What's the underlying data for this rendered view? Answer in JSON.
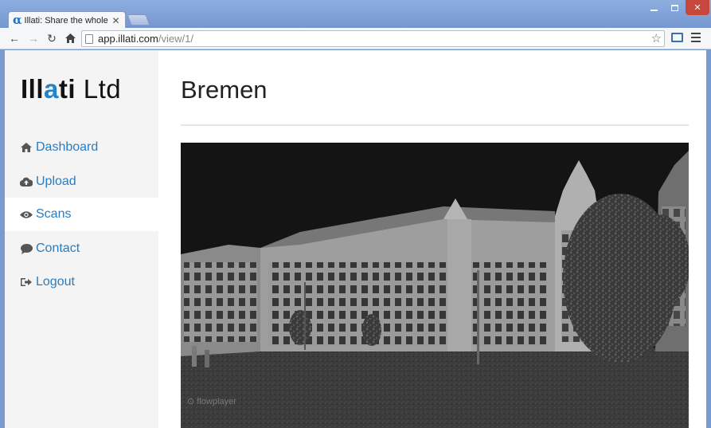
{
  "browser": {
    "tab_title": "Illati: Share the whole clou",
    "tab_favicon": "α",
    "url_host": "app.illati.com",
    "url_path": "/view/1/"
  },
  "sidebar": {
    "logo": {
      "part1": "Ill",
      "part2": "a",
      "part3": "ti",
      "part4": " Ltd"
    },
    "items": [
      {
        "label": "Dashboard",
        "icon": "home-icon"
      },
      {
        "label": "Upload",
        "icon": "cloud-upload-icon"
      },
      {
        "label": "Scans",
        "icon": "eye-icon",
        "active": true
      },
      {
        "label": "Contact",
        "icon": "comment-icon"
      },
      {
        "label": "Logout",
        "icon": "logout-icon"
      }
    ]
  },
  "main": {
    "title": "Bremen",
    "player_brand": "flowplayer"
  },
  "colors": {
    "accent": "#2a7cbf",
    "logo_accent": "#2582c4",
    "sidebar_bg": "#f4f4f4",
    "player_bg": "#141414"
  }
}
